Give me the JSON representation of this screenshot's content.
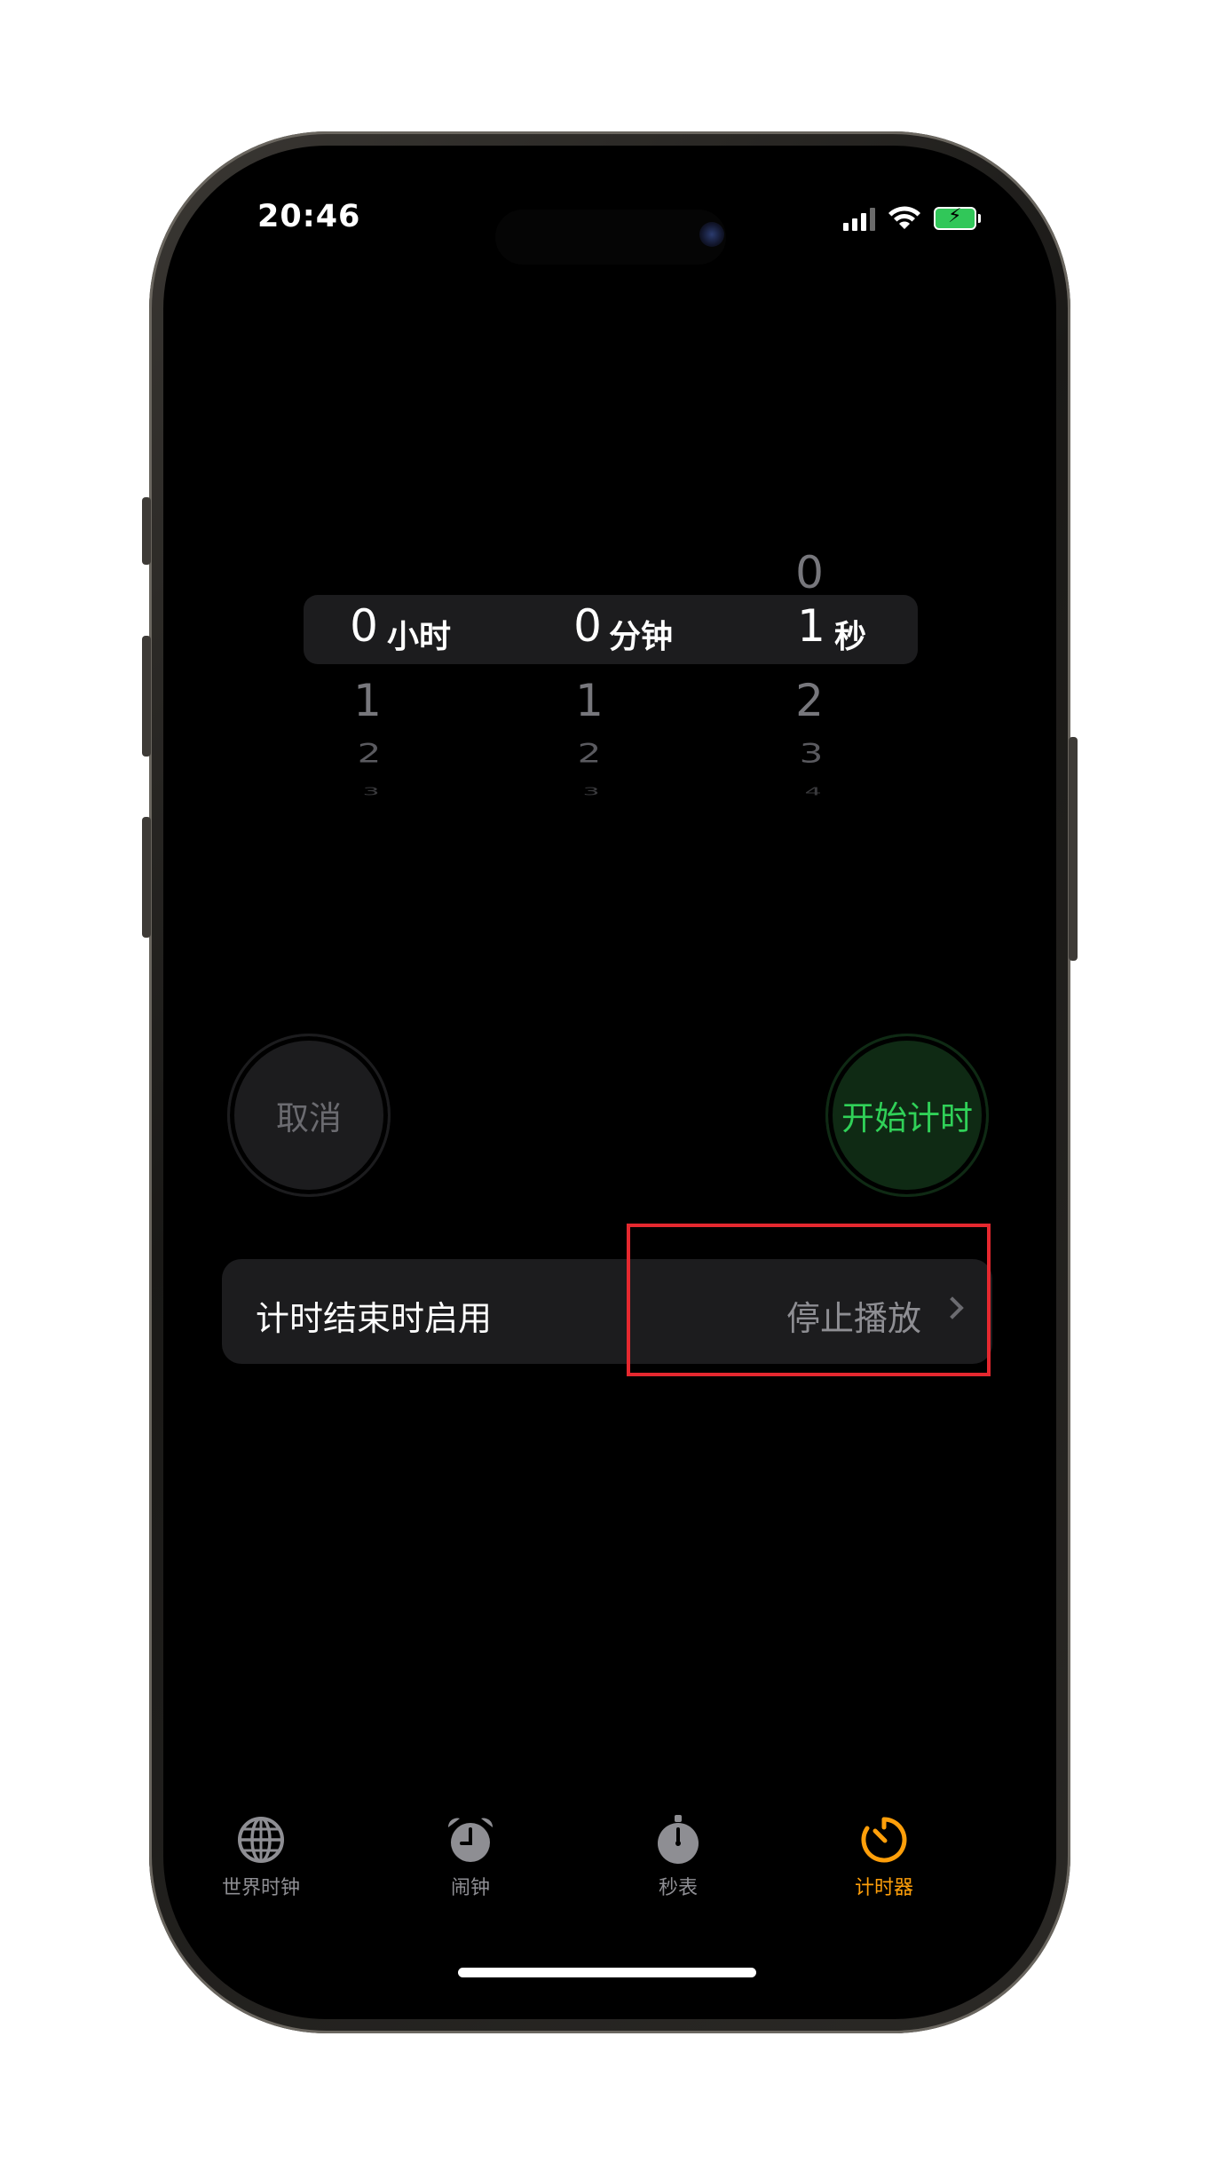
{
  "status_bar": {
    "time": "20:46",
    "icons": [
      "signal-icon",
      "wifi-icon",
      "battery-charging-icon"
    ]
  },
  "picker": {
    "hours": {
      "above": [],
      "selected": "0",
      "below": [
        "1",
        "2",
        "3"
      ],
      "unit": "小时"
    },
    "minutes": {
      "above": [],
      "selected": "0",
      "below": [
        "1",
        "2",
        "3"
      ],
      "unit": "分钟"
    },
    "seconds": {
      "above": [
        "0"
      ],
      "selected": "1",
      "below": [
        "2",
        "3",
        "4"
      ],
      "unit": "秒"
    }
  },
  "buttons": {
    "cancel": "取消",
    "start": "开始计时"
  },
  "when_timer_ends": {
    "label": "计时结束时启用",
    "value": "停止播放"
  },
  "tabs": [
    {
      "label": "世界时钟",
      "icon": "globe-icon",
      "active": false
    },
    {
      "label": "闹钟",
      "icon": "alarm-clock-icon",
      "active": false
    },
    {
      "label": "秒表",
      "icon": "stopwatch-icon",
      "active": false
    },
    {
      "label": "计时器",
      "icon": "timer-icon",
      "active": true
    }
  ],
  "colors": {
    "accent_orange": "#ff9f0a",
    "start_green": "#30d158",
    "highlight_red": "#e5282f"
  }
}
